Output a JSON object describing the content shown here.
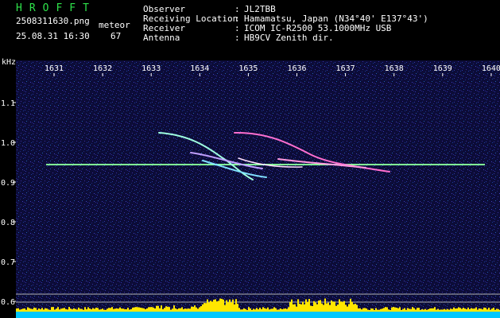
{
  "app": {
    "title": "HROFFT"
  },
  "file": {
    "name": "2508311630.png",
    "datetime": "25.08.31 16:30"
  },
  "meteor": {
    "label": "meteor",
    "count": "67"
  },
  "station": [
    {
      "key": "Observer",
      "value": "JL2TBB"
    },
    {
      "key": "Receiving Location",
      "value": "Hamamatsu, Japan (N34°40' E137°43')"
    },
    {
      "key": "Receiver",
      "value": "ICOM IC-R2500 53.1000MHz USB"
    },
    {
      "key": "Antenna",
      "value": "HB9CV Zenith dir."
    }
  ],
  "axis": {
    "unit": "kHz",
    "x_ticks": [
      "1631",
      "1632",
      "1633",
      "1634",
      "1635",
      "1636",
      "1637",
      "1638",
      "1639",
      "1640"
    ],
    "y_ticks": [
      "1.1",
      "1.0",
      "0.9",
      "0.8",
      "0.7",
      "0.6"
    ]
  },
  "colors": {
    "background": "#000000",
    "noise": "#10104a",
    "carrier": "#60ffa0",
    "echo": "#ff6fd0",
    "level_bar": "#ffe600",
    "level_base": "#00c8ff",
    "title": "#2ee34a"
  }
}
